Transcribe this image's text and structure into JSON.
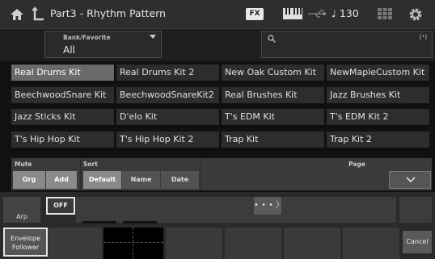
{
  "titlebar": {
    "title": "Part3 - Rhythm Pattern",
    "fx_label": "FX",
    "tempo": "♩ 130",
    "icons": [
      "home-icon",
      "back-arrow-icon",
      "keyboard-icon",
      "usb-icon",
      "grid-icon",
      "gear-icon"
    ]
  },
  "bank": {
    "label": "Bank/Favorite",
    "value": "All"
  },
  "search": {
    "placeholder": "",
    "bracket": "[*]"
  },
  "kits": [
    {
      "name": "Real Drums Kit",
      "selected": true
    },
    {
      "name": "Real Drums Kit 2",
      "selected": false
    },
    {
      "name": "New Oak Custom Kit",
      "selected": false
    },
    {
      "name": "NewMapleCustom Kit",
      "selected": false
    },
    {
      "name": "BeechwoodSnare Kit",
      "selected": false
    },
    {
      "name": "BeechwoodSnareKit2",
      "selected": false
    },
    {
      "name": "Real Brushes Kit",
      "selected": false
    },
    {
      "name": "Jazz Brushes Kit",
      "selected": false
    },
    {
      "name": "Jazz Sticks Kit",
      "selected": false
    },
    {
      "name": "D'elo Kit",
      "selected": false
    },
    {
      "name": "T's EDM Kit",
      "selected": false
    },
    {
      "name": "T's EDM Kit 2",
      "selected": false
    },
    {
      "name": "T's Hip Hop Kit",
      "selected": false
    },
    {
      "name": "T's Hip Hop Kit 2",
      "selected": false
    },
    {
      "name": "Trap Kit",
      "selected": false
    },
    {
      "name": "Trap Kit 2",
      "selected": false
    }
  ],
  "mute": {
    "label": "Mute",
    "org": "Org",
    "add": "Add"
  },
  "sort": {
    "label": "Sort",
    "default": "Default",
    "name": "Name",
    "date": "Date"
  },
  "page": {
    "label": "Page"
  },
  "arp": {
    "label": "Arp",
    "off": "OFF",
    "dots": "• • • 〉"
  },
  "envelope": {
    "line1": "Envelope",
    "line2": "Follower"
  },
  "cancel": "Cancel"
}
